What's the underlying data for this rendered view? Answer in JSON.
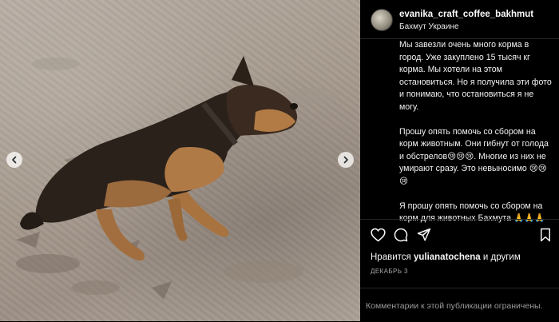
{
  "post": {
    "username": "evanika_craft_coffee_bakhmut",
    "location": "Бахмут Украине",
    "caption": [
      "Мы завезли очень много корма в город. Уже закуплено 15 тысяч кг корма. Мы хотели на этом остановиться. Но я получила эти фото и понимаю, что остановиться я не могу.",
      "Прошу опять помочь со сбором на корм животным. Они гибнут от голода и обстрелов😢😢😢. Многие из них не умирают сразу. Это невыносимо 😢😢😢",
      "Я прошу опять помочь со сбором на корм для животных Бахмута 🙏🙏🙏"
    ],
    "likes_prefix": "Нравится",
    "likes_user": "yulianatochena",
    "likes_suffix": "и другим",
    "date": "ДЕКАБРЬ 3",
    "comments_notice": "Комментарии к этой публикации ограничены."
  },
  "icons": {
    "like": "heart-icon",
    "comment": "comment-icon",
    "share": "paper-plane-icon",
    "save": "bookmark-icon",
    "prev": "chevron-left-icon",
    "next": "chevron-right-icon"
  },
  "colors": {
    "background": "#000000",
    "text": "#f5f5f5",
    "muted": "#a8a8a8",
    "divider": "#262626"
  }
}
